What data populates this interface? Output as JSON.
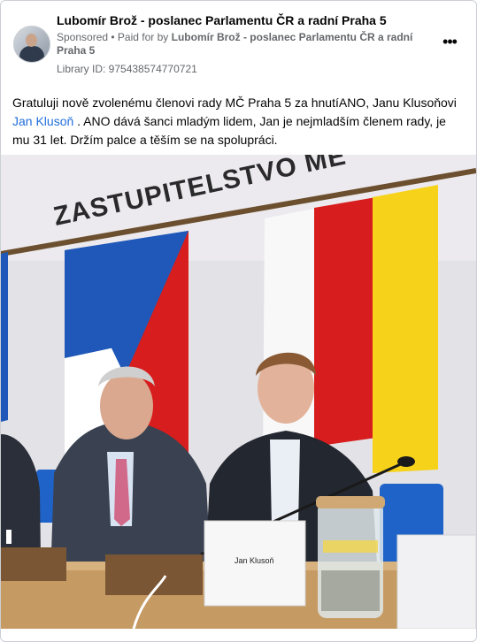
{
  "post": {
    "page_name": "Lubomír Brož - poslanec Parlamentu ČR a radní Praha 5",
    "sponsored": "Sponsored",
    "separator": " • ",
    "paid_for_prefix": "Paid for by ",
    "paid_for_name": "Lubomír Brož - poslanec Parlamentu ČR a radní Praha 5",
    "library_id": "Library ID: 975438574770721",
    "more_glyph": "•••",
    "text_before": "Gratuluji nově zvolenému členovi rady MČ Praha 5 za hnutíANO, Janu Klusoňovi ",
    "mention": "Jan Klusoň",
    "text_after": " . ANO dává šanci mladým lidem, Jan je nejmladším členem rady, je mu 31 let. Držím palce a těším se na spolupráci."
  },
  "photo": {
    "wall_sign": "ZASTUPITELSTVO MĚ",
    "name_card": "Jan Klusoň"
  },
  "colors": {
    "link": "#216fdb",
    "secondary_text": "#65676b",
    "flag_blue": "#1f58b8",
    "flag_red": "#d71d1d",
    "flag_yellow": "#f6d21a"
  }
}
